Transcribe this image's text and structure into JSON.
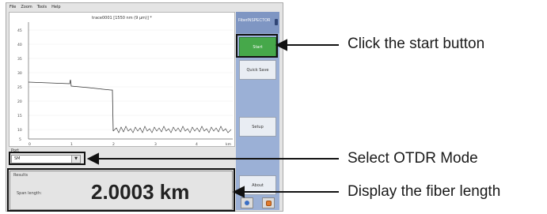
{
  "menu": [
    "File",
    "Zoom",
    "Tools",
    "Help"
  ],
  "plot": {
    "title": "trace0001 [1550 nm (9 µm)] *",
    "y_ticks": [
      "45",
      "40",
      "35",
      "30",
      "25",
      "20",
      "15",
      "10",
      "5"
    ],
    "x_ticks": [
      "0",
      "1",
      "2",
      "3",
      "4",
      "5",
      "km"
    ]
  },
  "side_panel": {
    "header_label": "FiberINSPECTOR",
    "buttons": {
      "start": "Start",
      "quick_save": "Quick Save",
      "setup": "Setup",
      "about": "About"
    }
  },
  "port": {
    "label": "Port",
    "value": "SM"
  },
  "results": {
    "label": "Results",
    "span_label": "Span length:",
    "span_value": "2.0003 km"
  },
  "annotations": {
    "start": "Click the start button",
    "mode": "Select OTDR Mode",
    "length": "Display the fiber length"
  },
  "colors": {
    "start_button": "#46a84a",
    "panel": "#9bb0d6",
    "panel_header": "#7f96c3",
    "trace": "#333333"
  },
  "icons": {
    "about_left": "blue-dot-icon",
    "about_right": "orange-square-icon",
    "dropdown": "chevron-down-icon"
  }
}
